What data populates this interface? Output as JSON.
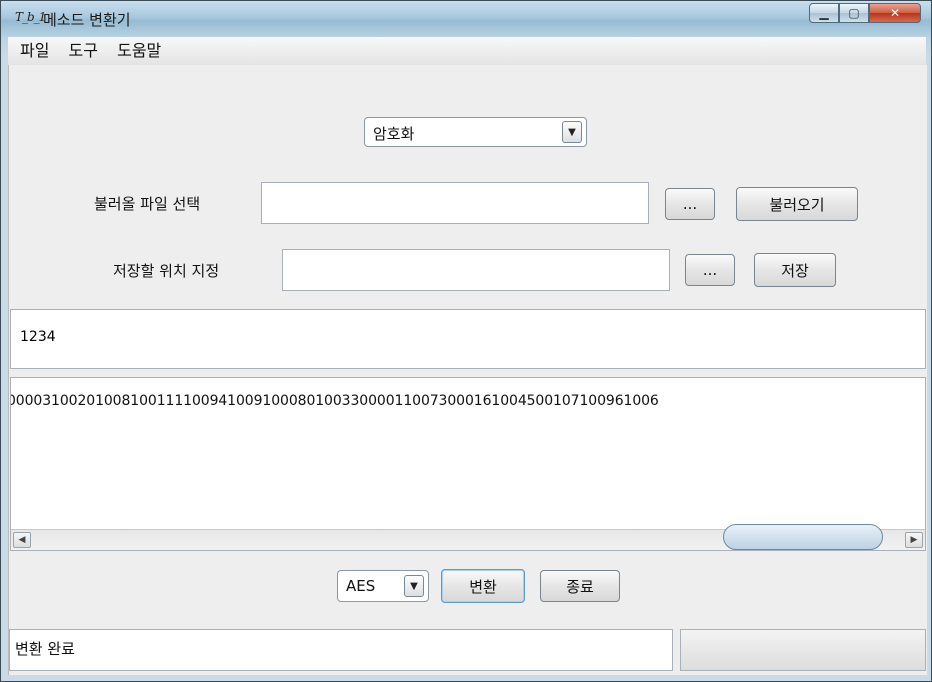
{
  "window": {
    "icon": "T_b_1",
    "title": "메소드 변환기"
  },
  "menu": [
    "파일",
    "도구",
    "도움말"
  ],
  "mode_select": {
    "value": "암호화"
  },
  "load_row": {
    "label": "불러올 파일 선택",
    "path": "",
    "browse": "...",
    "action": "불러오기"
  },
  "save_row": {
    "label": "저장할 위치 지정",
    "path": "",
    "browse": "...",
    "action": "저장"
  },
  "input_text": "1234",
  "output_text": "00003100201008100111100941009100080100330000110073000161004500107100961006",
  "algorithm_select": {
    "value": "AES"
  },
  "buttons": {
    "convert": "변환",
    "exit": "종료"
  },
  "status": "변환 완료"
}
